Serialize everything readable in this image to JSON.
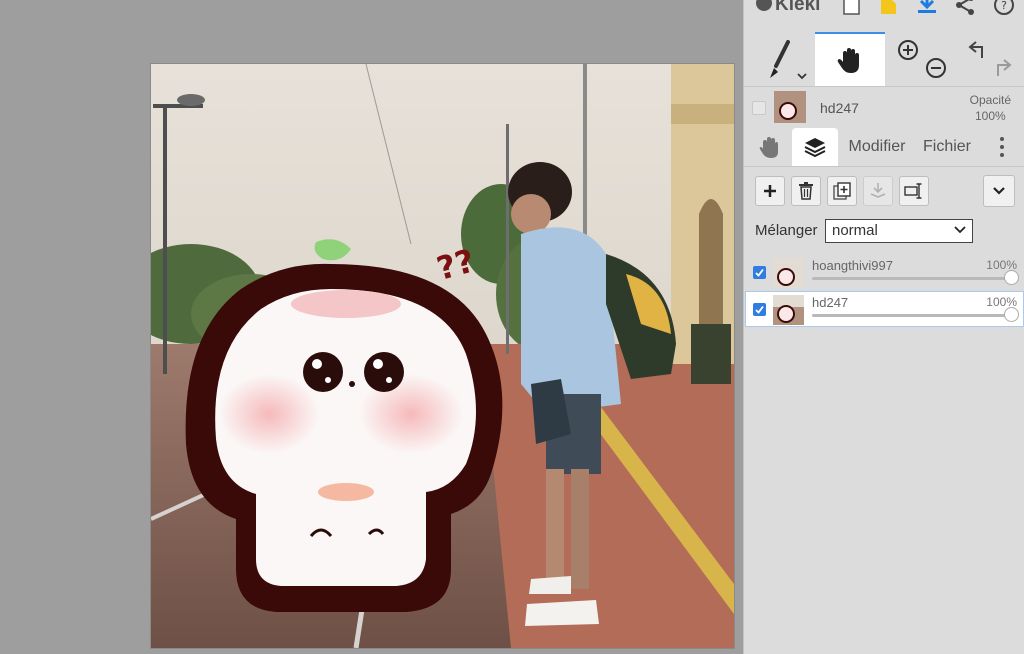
{
  "app": {
    "logo_text": "Kleki"
  },
  "topbar": {
    "icons": [
      "new-file-icon",
      "open-folder-icon",
      "download-icon",
      "share-icon",
      "help-icon"
    ]
  },
  "tools": {
    "items": [
      "brush-icon",
      "hand-icon",
      "zoom-in-icon",
      "zoom-out-icon",
      "undo-icon",
      "redo-icon"
    ],
    "active": "hand-icon"
  },
  "current_layer": {
    "name": "hd247",
    "opacity_label": "Opacité",
    "opacity_value": "100%"
  },
  "tabs": {
    "items": [
      {
        "icon": "hand-icon"
      },
      {
        "icon": "layers-icon"
      },
      {
        "label": "Modifier"
      },
      {
        "label": "Fichier"
      }
    ],
    "active": "layers-icon"
  },
  "layer_actions": {
    "icons": [
      "add-layer-icon",
      "delete-layer-icon",
      "duplicate-layer-icon",
      "merge-down-icon",
      "rename-layer-icon",
      "chevron-down-icon"
    ]
  },
  "blend": {
    "label": "Mélanger",
    "value": "normal"
  },
  "layers": [
    {
      "name": "hoangthivi997",
      "opacity": "100%",
      "opacity_fraction": 1.0,
      "visible": true,
      "selected": false
    },
    {
      "name": "hd247",
      "opacity": "100%",
      "opacity_fraction": 1.0,
      "visible": true,
      "selected": true
    }
  ],
  "colors": {
    "accent": "#3a8ee6",
    "checkbox": "#2f7de1",
    "panel_bg": "#dcdcdc",
    "workspace_bg": "#9e9e9e"
  }
}
